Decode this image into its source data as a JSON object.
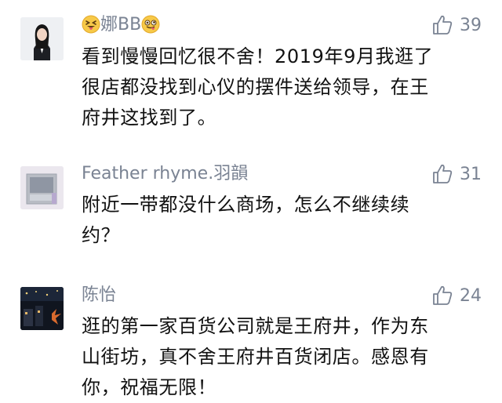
{
  "comments": [
    {
      "author": "娜BB",
      "likes": "39",
      "text": "看到慢慢回忆很不舍！2019年9月我逛了\n很店都没找到心仪的摆件送给领导，在王\n府井这找到了。"
    },
    {
      "author": "Feather rhyme.羽韻",
      "likes": "31",
      "text": "附近一带都没什么商场，怎么不继续续\n约？"
    },
    {
      "author": "陈怡",
      "likes": "24",
      "text": "逛的第一家百货公司就是王府井，作为东\n山街坊，真不舍王府井百货闭店。感恩有\n你，祝福无限！"
    }
  ],
  "icons": {
    "like": "thumbs-up-outline-icon",
    "name_emoji_left": "squinting-tongue-emoji",
    "name_emoji_right": "winking-tongue-emoji"
  },
  "colors": {
    "meta_text": "#7a8393",
    "body_text": "#111111",
    "background": "#ffffff"
  }
}
